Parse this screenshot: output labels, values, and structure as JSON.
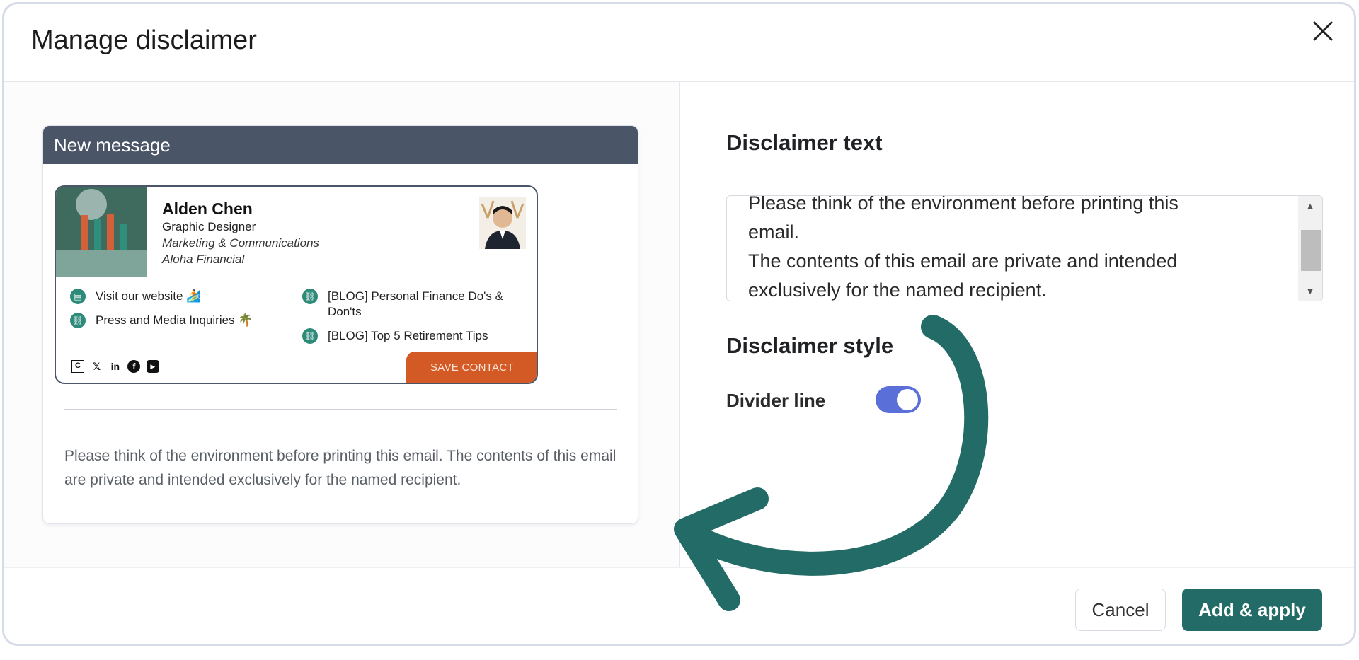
{
  "dialog": {
    "title": "Manage disclaimer",
    "close_icon": "close-icon"
  },
  "preview": {
    "header": "New message",
    "signature": {
      "name": "Alden Chen",
      "role": "Graphic Designer",
      "department": "Marketing & Communications",
      "company": "Aloha Financial",
      "links": [
        {
          "label": "Visit our website 🏄",
          "icon": "globe-icon"
        },
        {
          "label": "Press and Media Inquiries 🌴",
          "icon": "link-icon"
        },
        {
          "label": "[BLOG] Personal Finance Do's & Don'ts",
          "icon": "link-icon"
        },
        {
          "label": "[BLOG] Top 5 Retirement Tips",
          "icon": "link-icon"
        }
      ],
      "social_icons": [
        "calendar-icon",
        "x-icon",
        "linkedin-icon",
        "facebook-icon",
        "youtube-icon"
      ],
      "save_contact": "SAVE CONTACT"
    },
    "disclaimer": "Please think of the environment before printing this email. The contents of this email are private and intended exclusively for the named recipient."
  },
  "settings": {
    "text_title": "Disclaimer text",
    "text_lines": [
      "Please think of the environment before printing this",
      "email.",
      "The contents of this email are private and intended",
      "exclusively for the named recipient."
    ],
    "style_title": "Disclaimer style",
    "divider_label": "Divider line",
    "divider_enabled": true
  },
  "footer": {
    "cancel": "Cancel",
    "apply": "Add & apply"
  },
  "colors": {
    "primary": "#226b66",
    "toggle": "#5a6fd8",
    "save_contact": "#d35a24",
    "arrow": "#226b66"
  }
}
